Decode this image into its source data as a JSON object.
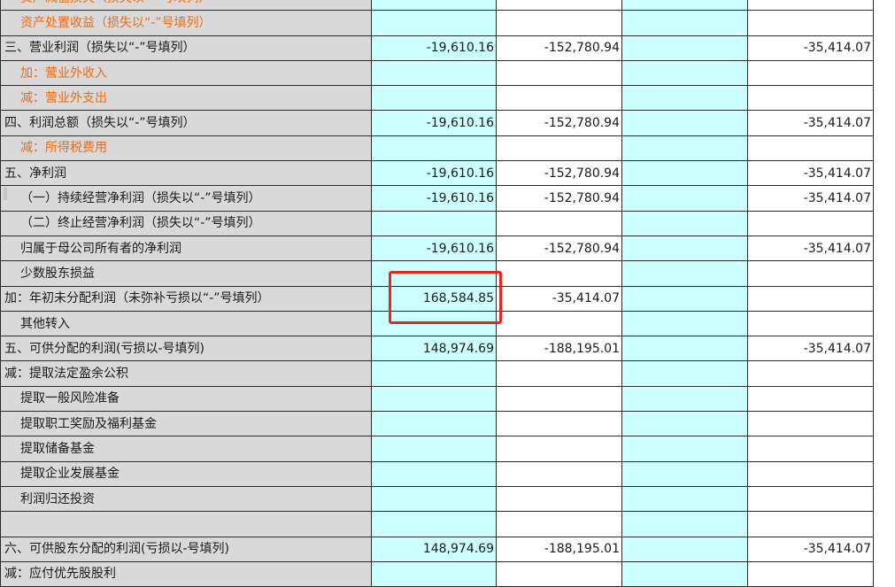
{
  "rows": [
    {
      "label": "资产减值损失（损失以“-”号填列）",
      "cls": "orange indent",
      "v": [
        "",
        "",
        "",
        ""
      ]
    },
    {
      "label": "资产处置收益（损失以“-”号填列）",
      "cls": "orange indent",
      "v": [
        "",
        "",
        "",
        ""
      ]
    },
    {
      "label": "三、营业利润（损失以“-”号填列）",
      "cls": "",
      "v": [
        "-19,610.16",
        "-152,780.94",
        "",
        "-35,414.07"
      ]
    },
    {
      "label": "加：营业外收入",
      "cls": "orange indent",
      "v": [
        "",
        "",
        "",
        ""
      ]
    },
    {
      "label": "减：营业外支出",
      "cls": "orange indent",
      "v": [
        "",
        "",
        "",
        ""
      ]
    },
    {
      "label": "四、利润总额（损失以“-”号填列）",
      "cls": "",
      "v": [
        "-19,610.16",
        "-152,780.94",
        "",
        "-35,414.07"
      ]
    },
    {
      "label": "减：所得税费用",
      "cls": "orange indent",
      "v": [
        "",
        "",
        "",
        ""
      ]
    },
    {
      "label": "五、净利润",
      "cls": "",
      "v": [
        "-19,610.16",
        "-152,780.94",
        "",
        "-35,414.07"
      ]
    },
    {
      "label": "（一）持续经营净利润（损失以“-”号填列）",
      "cls": "indent",
      "v": [
        "-19,610.16",
        "-152,780.94",
        "",
        "-35,414.07"
      ]
    },
    {
      "label": "（二）终止经营净利润（损失以“-”号填列）",
      "cls": "indent",
      "v": [
        "",
        "",
        "",
        ""
      ]
    },
    {
      "label": "归属于母公司所有者的净利润",
      "cls": "indent",
      "v": [
        "-19,610.16",
        "-152,780.94",
        "",
        "-35,414.07"
      ]
    },
    {
      "label": "少数股东损益",
      "cls": "indent",
      "v": [
        "",
        "",
        "",
        ""
      ]
    },
    {
      "label": "加：年初未分配利润（未弥补亏损以“-”号填列）",
      "cls": "",
      "v": [
        "168,584.85",
        "-35,414.07",
        "",
        ""
      ]
    },
    {
      "label": "其他转入",
      "cls": "indent",
      "v": [
        "",
        "",
        "",
        ""
      ]
    },
    {
      "label": "五、可供分配的利润(亏损以-号填列)",
      "cls": "",
      "v": [
        "148,974.69",
        "-188,195.01",
        "",
        "-35,414.07"
      ]
    },
    {
      "label": "减：提取法定盈余公积",
      "cls": "",
      "v": [
        "",
        "",
        "",
        ""
      ]
    },
    {
      "label": "提取一般风险准备",
      "cls": "indent",
      "v": [
        "",
        "",
        "",
        ""
      ]
    },
    {
      "label": "提取职工奖励及福利基金",
      "cls": "indent",
      "v": [
        "",
        "",
        "",
        ""
      ]
    },
    {
      "label": "提取储备基金",
      "cls": "indent",
      "v": [
        "",
        "",
        "",
        ""
      ]
    },
    {
      "label": "提取企业发展基金",
      "cls": "indent",
      "v": [
        "",
        "",
        "",
        ""
      ]
    },
    {
      "label": "利润归还投资",
      "cls": "indent",
      "v": [
        "",
        "",
        "",
        ""
      ]
    },
    {
      "label": "",
      "cls": "",
      "v": [
        "",
        "",
        "",
        ""
      ]
    },
    {
      "label": "六、可供股东分配的利润(亏损以-号填列)",
      "cls": "",
      "v": [
        "148,974.69",
        "-188,195.01",
        "",
        "-35,414.07"
      ]
    },
    {
      "label": "减：应付优先股股利",
      "cls": "",
      "v": [
        "",
        "",
        "",
        ""
      ]
    }
  ]
}
